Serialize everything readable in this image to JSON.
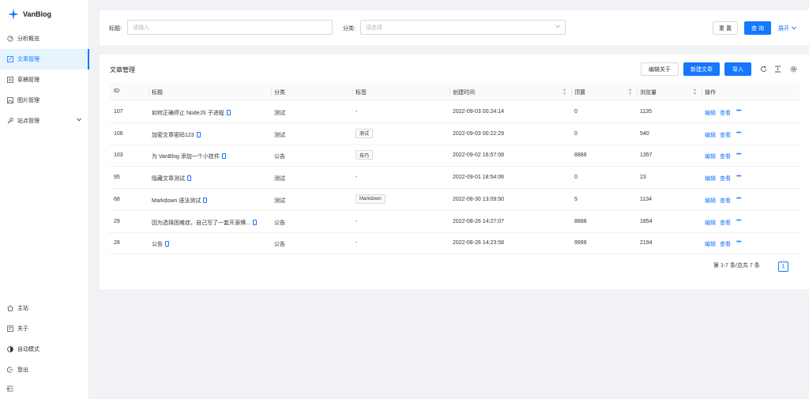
{
  "app": {
    "name": "VanBlog",
    "logo_icon": "vanblog-logo-icon",
    "accent": "#1677ff"
  },
  "sidebar": {
    "items": [
      {
        "label": "分析概览",
        "icon": "dashboard-icon",
        "active": false
      },
      {
        "label": "文章管理",
        "icon": "article-icon",
        "active": true
      },
      {
        "label": "草稿管理",
        "icon": "draft-icon",
        "active": false
      },
      {
        "label": "图片管理",
        "icon": "image-icon",
        "active": false
      },
      {
        "label": "站点管理",
        "icon": "wrench-icon",
        "active": false,
        "expandable": true
      }
    ],
    "bottom_items": [
      {
        "label": "主站",
        "icon": "home-icon"
      },
      {
        "label": "关于",
        "icon": "info-icon"
      },
      {
        "label": "自动模式",
        "icon": "theme-icon"
      },
      {
        "label": "登出",
        "icon": "logout-icon"
      }
    ]
  },
  "search": {
    "title_label": "标题:",
    "title_placeholder": "请输入",
    "category_label": "分类:",
    "category_placeholder": "请选择",
    "reset_label": "重 置",
    "query_label": "查 询",
    "expand_label": "展开"
  },
  "table": {
    "title": "文章管理",
    "edit_about_label": "编辑关于",
    "new_article_label": "新建文章",
    "import_label": "导入",
    "columns": [
      "ID",
      "标题",
      "分类",
      "标签",
      "创建时间",
      "顶置",
      "浏览量",
      "操作"
    ],
    "rows": [
      {
        "id": "107",
        "title": "如何正确停止 NodeJS 子进程",
        "category": "测试",
        "tag": "-",
        "tag_is_chip": false,
        "created": "2022-09-03 00:24:14",
        "top": "0",
        "views": "1135"
      },
      {
        "id": "106",
        "title": "加密文章密码123",
        "category": "测试",
        "tag": "测试",
        "tag_is_chip": true,
        "created": "2022-09-03 00:22:29",
        "top": "0",
        "views": "540"
      },
      {
        "id": "103",
        "title": "为 VanBlog 添加一个小挂件",
        "category": "公告",
        "tag": "技巧",
        "tag_is_chip": true,
        "created": "2022-09-02 16:57:08",
        "top": "8889",
        "views": "1357"
      },
      {
        "id": "95",
        "title": "隐藏文章测试",
        "category": "测试",
        "tag": "-",
        "tag_is_chip": false,
        "created": "2022-09-01 18:54:06",
        "top": "0",
        "views": "23"
      },
      {
        "id": "68",
        "title": "Markdown 语法测试",
        "category": "测试",
        "tag": "Markdown",
        "tag_is_chip": true,
        "created": "2022-08-30 13:09:50",
        "top": "5",
        "views": "1134"
      },
      {
        "id": "29",
        "title": "因为选择困难症，自己写了一套开源博...",
        "category": "公告",
        "tag": "-",
        "tag_is_chip": false,
        "created": "2022-08-26 14:27:07",
        "top": "8888",
        "views": "1854"
      },
      {
        "id": "28",
        "title": "公告",
        "category": "公告",
        "tag": "-",
        "tag_is_chip": false,
        "created": "2022-08-26 14:23:58",
        "top": "9999",
        "views": "2194"
      }
    ],
    "actions": {
      "edit": "编辑",
      "view": "查看",
      "more": "•••"
    },
    "pagination": {
      "summary": "第 1-7 条/总共 7 条",
      "current_page": "1"
    }
  }
}
